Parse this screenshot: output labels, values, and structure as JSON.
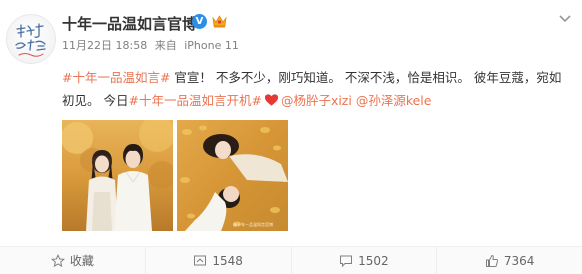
{
  "post": {
    "author": "十年一品温如言官博",
    "verified_badge": "V",
    "date": "11月22日 18:58",
    "source_prefix": "来自",
    "source": "iPhone 11",
    "content": {
      "tag1": "#十年一品温如言#",
      "text1": " 官宣！ 不多不少，刚巧知道。 不深不浅，恰是相识。 彼年豆蔻，宛如初见。 今日",
      "tag2": "#十年一品温如言开机#",
      "mention1": "@杨肸子xizi",
      "mention2": "@孙泽源kele"
    },
    "image_watermark": "@十年一品温如言官博"
  },
  "actions": {
    "favorite": "收藏",
    "repost": "1548",
    "comment": "1502",
    "like": "7364"
  },
  "colors": {
    "link": "#eb7350",
    "verified": "#2e8ee6",
    "heart": "#e53935"
  },
  "icons": [
    "verified-icon",
    "vip-crown-icon",
    "chevron-down-icon",
    "heart-icon",
    "star-icon",
    "repost-icon",
    "comment-icon",
    "like-icon"
  ]
}
